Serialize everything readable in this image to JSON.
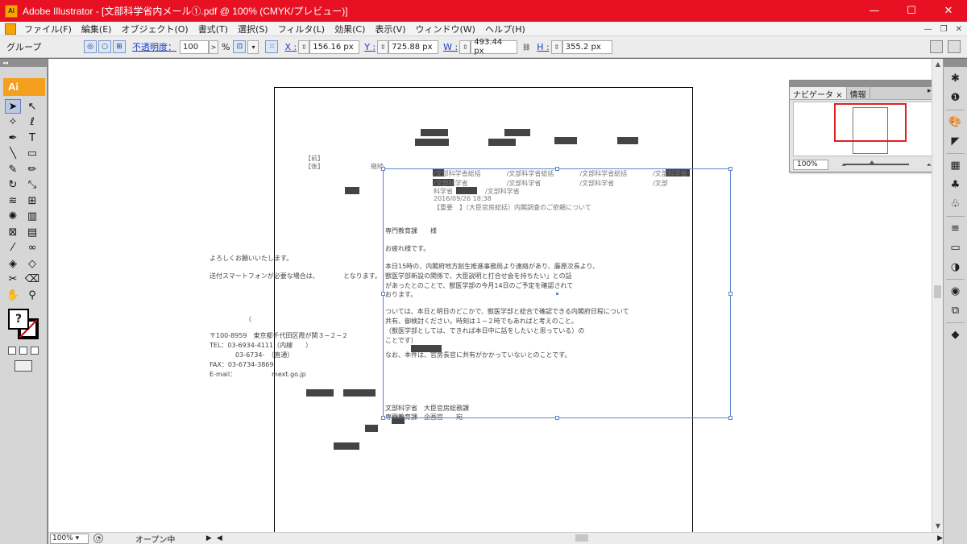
{
  "window": {
    "app_icon_text": "Ai",
    "title": "Adobe Illustrator - [文部科学省内メール①.pdf @ 100% (CMYK/プレビュー)]",
    "minimize": "—",
    "maximize": "☐",
    "close": "✕"
  },
  "menu": {
    "items": [
      "ファイル(F)",
      "編集(E)",
      "オブジェクト(O)",
      "書式(T)",
      "選択(S)",
      "フィルタ(L)",
      "効果(C)",
      "表示(V)",
      "ウィンドウ(W)",
      "ヘルプ(H)"
    ],
    "mdi_minimize": "—",
    "mdi_restore": "❐",
    "mdi_close": "✕"
  },
  "control": {
    "selection_label": "グループ",
    "opacity_label": "不透明度：",
    "opacity_value": "100",
    "opacity_arrow": ">",
    "opacity_unit": "%",
    "x_label": "X :",
    "x_value": "156.16 px",
    "y_label": "Y :",
    "y_value": "725.88 px",
    "w_label": "W :",
    "w_value": "493.44 px",
    "h_label": "H :",
    "h_value": "355.2 px"
  },
  "tools": {
    "header": "◂◂",
    "badge": "Ai",
    "fill_symbol": "?",
    "items": [
      {
        "name": "selection-tool",
        "glyph": "➤"
      },
      {
        "name": "direct-selection-tool",
        "glyph": "↖"
      },
      {
        "name": "magic-wand-tool",
        "glyph": "✧"
      },
      {
        "name": "lasso-tool",
        "glyph": "ℓ"
      },
      {
        "name": "pen-tool",
        "glyph": "✒"
      },
      {
        "name": "type-tool",
        "glyph": "T"
      },
      {
        "name": "line-tool",
        "glyph": "╲"
      },
      {
        "name": "rectangle-tool",
        "glyph": "▭"
      },
      {
        "name": "paintbrush-tool",
        "glyph": "✎"
      },
      {
        "name": "pencil-tool",
        "glyph": "✏"
      },
      {
        "name": "rotate-tool",
        "glyph": "↻"
      },
      {
        "name": "scale-tool",
        "glyph": "⤡"
      },
      {
        "name": "warp-tool",
        "glyph": "≋"
      },
      {
        "name": "free-transform-tool",
        "glyph": "⊞"
      },
      {
        "name": "symbol-sprayer-tool",
        "glyph": "✺"
      },
      {
        "name": "column-graph-tool",
        "glyph": "▥"
      },
      {
        "name": "mesh-tool",
        "glyph": "⊠"
      },
      {
        "name": "gradient-tool",
        "glyph": "▤"
      },
      {
        "name": "eyedropper-tool",
        "glyph": "⁄"
      },
      {
        "name": "blend-tool",
        "glyph": "∞"
      },
      {
        "name": "live-paint-bucket-tool",
        "glyph": "◈"
      },
      {
        "name": "live-paint-selection-tool",
        "glyph": "◇"
      },
      {
        "name": "slice-tool",
        "glyph": "✂"
      },
      {
        "name": "eraser-tool",
        "glyph": "⌫"
      },
      {
        "name": "hand-tool",
        "glyph": "✋"
      },
      {
        "name": "zoom-tool",
        "glyph": "⚲"
      }
    ]
  },
  "document": {
    "margin_notes": [
      "【前】",
      "【後】",
      "継続"
    ],
    "left_texts": [
      "よろしくお願いいたします。",
      "送付スマートフォンが必要な場合は、",
      "（",
      "〒100-8959　東京都千代田区霞が関３−２−２",
      "TEL：03-6934-4111（内線　　）",
      "　　　　03-6734-　（直通）",
      "FAX：03-6734-3869",
      "E-mail：　　　　　　mext.go.jp",
      "となります。"
    ],
    "email_lines": [
      "/文部科学省総括　　　　/文部科学省総括　　　　/文部科学省総括　　　　/文部科学省",
      "/文部科学省　　　　　　/文部科学省　　　　　　/文部科学省　　　　　　/文部",
      "科学省　　　　　/文部科学省",
      "2016/09/26 18:38",
      "【重要　】（大臣官房総括）内閣調査のご依頼について",
      "専門教育課　　様",
      "お疲れ様です。",
      "本日15時の、内閣府地方創生推進事務局より連絡があり、藤原次長より、",
      "獣医学部新設の関係で、大臣説明と打合せ会を持ちたい」との話",
      "があったとのことで、獣医学部の今月14日のご予定を確認されて",
      "おります。",
      "ついては、本日と明日のどこかで、獣医学部と総合で確認できる内閣府日程について",
      "共有、御検討ください。時刻は１−２時でもあればと考えのこと。",
      "（獣医学部としては、できれば本日中に話をしたいと思っている）の",
      "ことです）",
      "なお、本件は、官房長官に共有がかかっていないとのことです。",
      "文部科学省　大臣官房総務課",
      "専門教育課　企画官　　宛"
    ]
  },
  "navigator": {
    "tab_navigator": "ナビゲータ",
    "tab_close": "×",
    "tab_info": "情報",
    "menu_glyph": "▸≡",
    "zoom_value": "100%",
    "zoom_out_glyph": "⏶",
    "zoom_in_glyph": "⏶"
  },
  "dock": {
    "header": "◂◂",
    "icons": [
      "✱",
      "❶",
      "🎨",
      "◤",
      "▦",
      "♣",
      "♧",
      "≡",
      "▭",
      "◑",
      "◉",
      "⧉",
      "◆"
    ]
  },
  "scroll": {
    "up_arrow": "▲",
    "down_arrow": "▼"
  },
  "status": {
    "zoom_value": "100%",
    "zoom_arrow": "▾",
    "status_text": "オープン中",
    "status_arrow": "▶",
    "left_arrow": "◀",
    "right_arrow": "▶"
  }
}
